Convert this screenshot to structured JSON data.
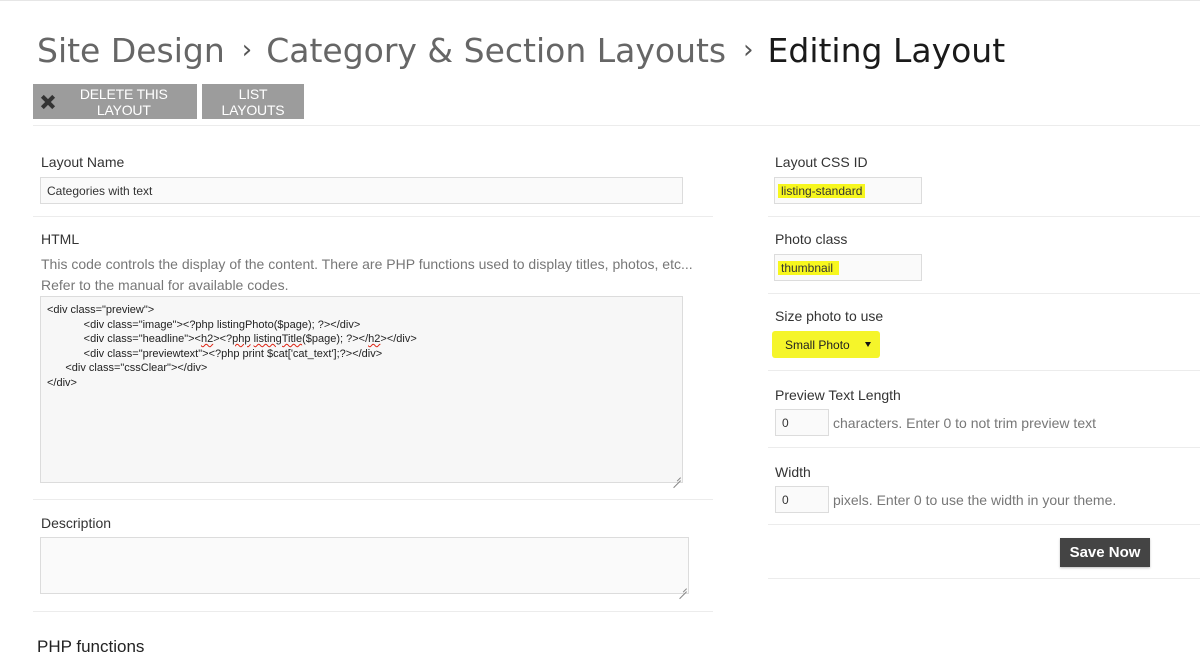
{
  "breadcrumb": {
    "items": [
      "Site Design",
      "Category & Section Layouts"
    ],
    "separator": "›",
    "current": "Editing Layout"
  },
  "toolbar": {
    "delete_label": "DELETE THIS LAYOUT",
    "list_label": "LIST LAYOUTS"
  },
  "form": {
    "layout_name": {
      "label": "Layout Name",
      "value": "Categories with text"
    },
    "html": {
      "label": "HTML",
      "help": "This code controls the display of the content. There are PHP functions used to display titles, photos, etc... Refer to the manual for available codes.",
      "code_lines": [
        "<div class=\"preview\">",
        "            <div class=\"image\"><?php listingPhoto($page); ?></div>",
        "            <div class=\"headline\"><h2><?php listingTitle($page); ?></h2></div>",
        "            <div class=\"previewtext\"><?php print $cat['cat_text'];?></div>",
        "      <div class=\"cssClear\"></div>",
        "</div>"
      ]
    },
    "description": {
      "label": "Description",
      "value": ""
    },
    "layout_css_id": {
      "label": "Layout CSS ID",
      "value": "listing-standard"
    },
    "photo_class": {
      "label": "Photo class",
      "value": "thumbnail"
    },
    "size_photo": {
      "label": "Size photo to use",
      "selected": "Small Photo"
    },
    "preview_text_length": {
      "label": "Preview Text Length",
      "value": "0",
      "suffix": "characters. Enter 0 to not trim preview text"
    },
    "width": {
      "label": "Width",
      "value": "0",
      "suffix": "pixels. Enter 0 to use the width in your theme."
    },
    "save_label": "Save Now"
  },
  "php_functions": {
    "heading": "PHP functions"
  },
  "colors": {
    "highlight": "#f7f71e",
    "button_gray": "#9c9c9c",
    "save_button": "#444444"
  }
}
